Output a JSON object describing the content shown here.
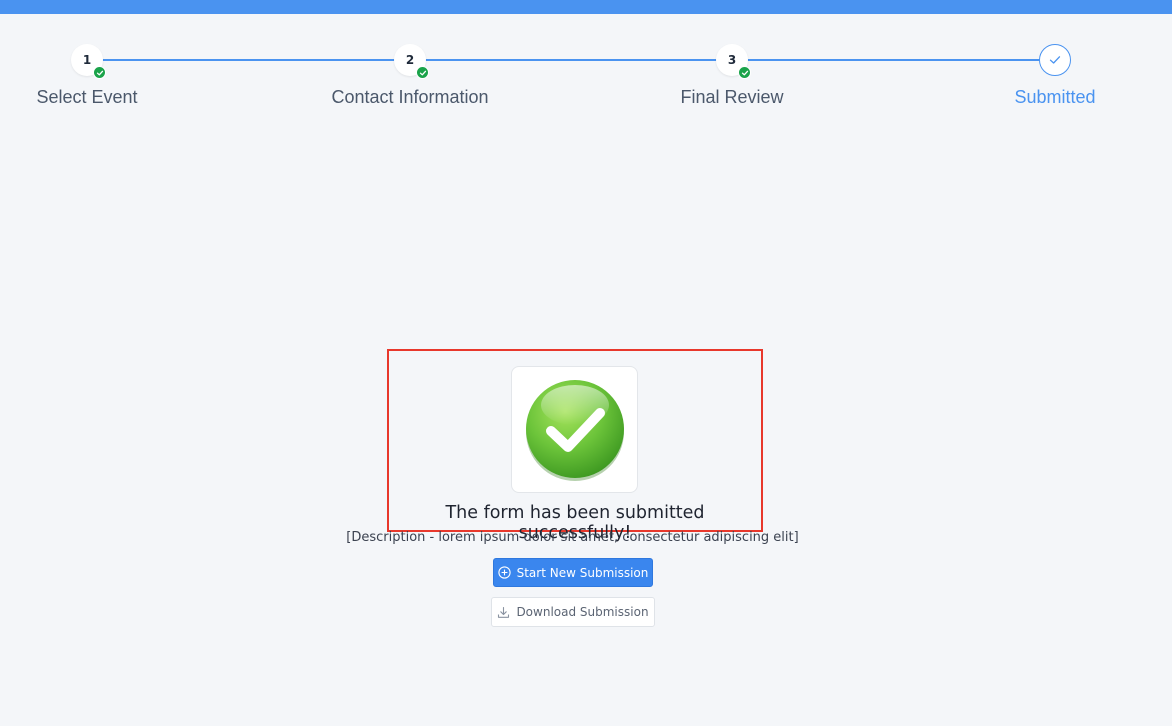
{
  "steps": [
    {
      "number": "1",
      "label": "Select Event",
      "status": "completed"
    },
    {
      "number": "2",
      "label": "Contact Information",
      "status": "completed"
    },
    {
      "number": "3",
      "label": "Final Review",
      "status": "completed"
    },
    {
      "number": "",
      "label": "Submitted",
      "status": "active"
    }
  ],
  "success": {
    "icon": "success-check-icon",
    "title": "The form has been submitted successfully!",
    "description": "[Description - lorem ipsum dolor sit amet, consectetur adipiscing elit]"
  },
  "actions": {
    "start_new_label": "Start New Submission",
    "start_new_icon": "plus-circle-icon",
    "download_label": "Download Submission",
    "download_icon": "download-icon"
  },
  "colors": {
    "accent": "#4a93f0",
    "completed_badge": "#1aa34a",
    "highlight_border": "#e8382c",
    "success_green": "#6cc43a"
  }
}
